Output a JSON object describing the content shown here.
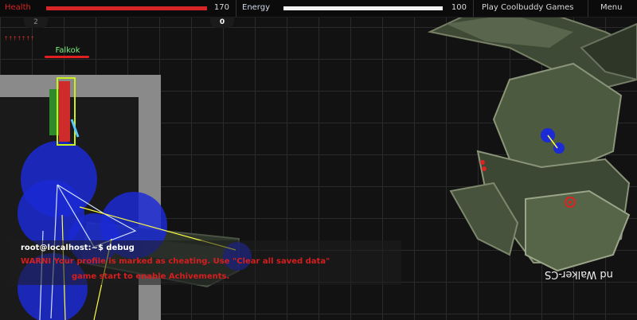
{
  "hud": {
    "health_label": "Health",
    "health_value": "170",
    "health_fraction": 1.0,
    "energy_label": "Energy",
    "energy_value": "100",
    "energy_fraction": 1.0,
    "play_link": "Play Coolbuddy Games",
    "menu_label": "Menu",
    "colors": {
      "health": "#d72424",
      "energy": "#f2f2f2"
    }
  },
  "counters": {
    "left": "2",
    "right": "0"
  },
  "player": {
    "name": "Falkok",
    "markers": "†††††††"
  },
  "console": {
    "prompt": "root@localhost:~$ debug",
    "warning_line1": "WARNI     Your profile is marked as cheating. Use \"Clear all saved data\"",
    "warning_line2": "game start to enable Achivements."
  },
  "boss": {
    "label": "nd Walker-CS"
  }
}
